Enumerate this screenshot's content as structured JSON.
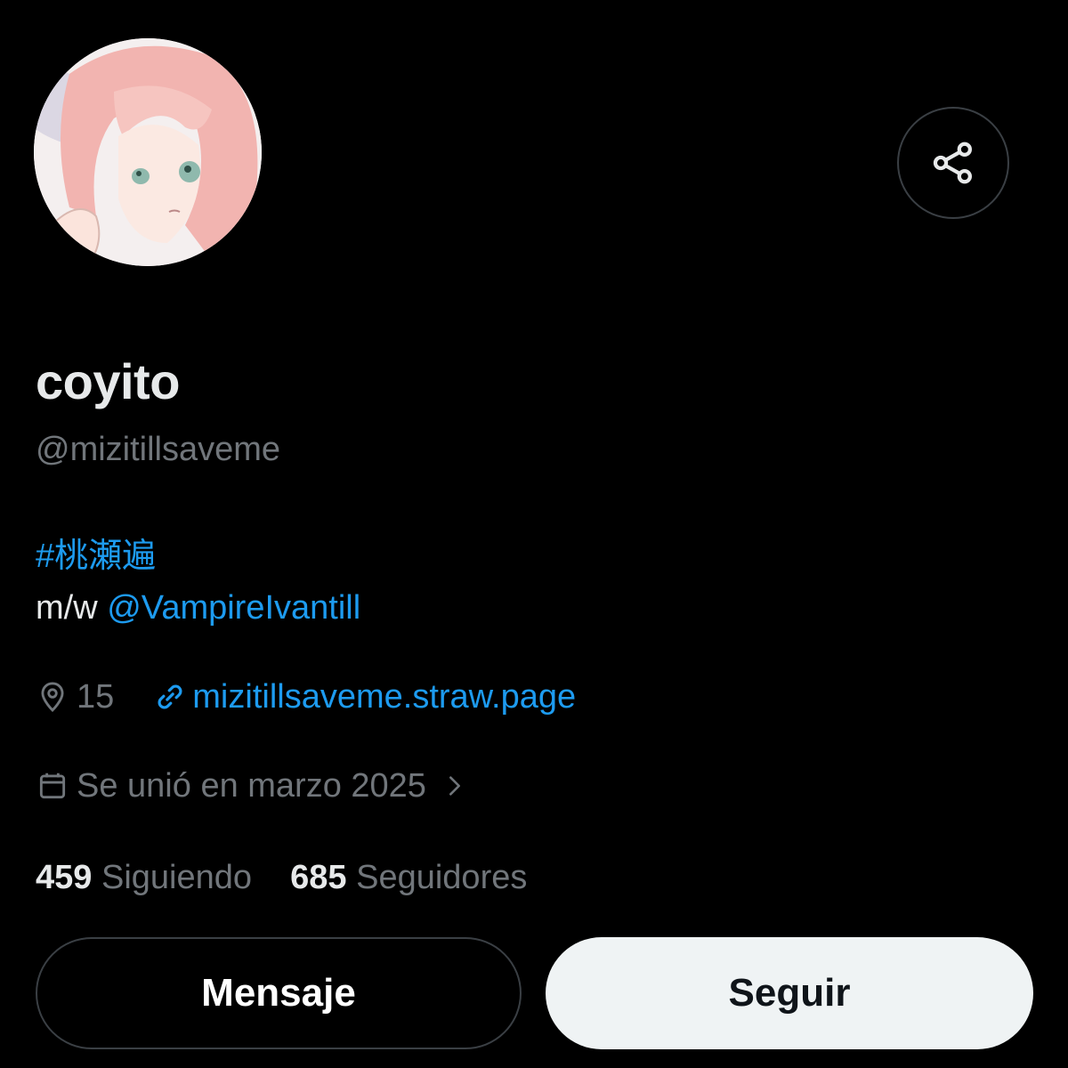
{
  "profile": {
    "display_name": "coyito",
    "handle": "@mizitillsaveme",
    "bio_hashtag": "#桃瀬遍",
    "bio_prefix": "m/w",
    "bio_mention": "@VampireIvantill",
    "location": "15",
    "website": "mizitillsaveme.straw.page",
    "joined": "Se unió en marzo 2025"
  },
  "stats": {
    "following_count": "459",
    "following_label": "Siguiendo",
    "followers_count": "685",
    "followers_label": "Seguidores"
  },
  "buttons": {
    "message_label": "Mensaje",
    "follow_label": "Seguir"
  },
  "icons": {
    "share": "share-icon",
    "location": "location-pin-icon",
    "link": "link-icon",
    "calendar": "calendar-icon",
    "chevron": "chevron-right-icon"
  },
  "colors": {
    "background": "#000000",
    "text_primary": "#e7e9ea",
    "text_secondary": "#71767b",
    "accent": "#1d9bf0",
    "follow_button_bg": "#eff3f4"
  }
}
